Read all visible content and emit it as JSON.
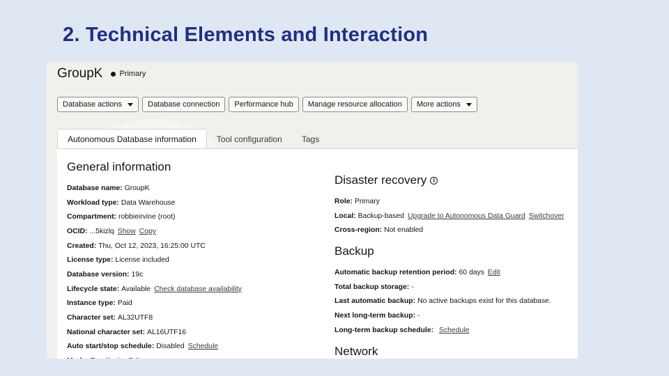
{
  "slide": {
    "title": "2. Technical Elements and Interaction"
  },
  "header": {
    "db_name": "GroupK",
    "status": "Primary"
  },
  "actions": {
    "database_actions": "Database actions",
    "database_connection": "Database connection",
    "performance_hub": "Performance hub",
    "manage_resource": "Manage resource allocation",
    "more_actions": "More actions"
  },
  "tabs": [
    {
      "label": "Autonomous Database information"
    },
    {
      "label": "Tool configuration"
    },
    {
      "label": "Tags"
    }
  ],
  "general": {
    "title": "General information",
    "rows": [
      {
        "label": "Database name:",
        "value": "GroupK"
      },
      {
        "label": "Workload type:",
        "value": "Data Warehouse"
      },
      {
        "label": "Compartment:",
        "value": "robbieirvine (root)"
      },
      {
        "label": "OCID:",
        "value": "...5kizlq",
        "link1": "Show",
        "link2": "Copy"
      },
      {
        "label": "Created:",
        "value": "Thu, Oct 12, 2023, 16:25:00 UTC"
      },
      {
        "label": "License type:",
        "value": "License included"
      },
      {
        "label": "Database version:",
        "value": "19c"
      },
      {
        "label": "Lifecycle state:",
        "value": "Available",
        "link1": "Check database availability"
      },
      {
        "label": "Instance type:",
        "value": "Paid"
      },
      {
        "label": "Character set:",
        "value": "AL32UTF8"
      },
      {
        "label": "National character set:",
        "value": "AL16UTF16"
      },
      {
        "label": "Auto start/stop schedule:",
        "value": "Disabled",
        "link1": "Schedule"
      },
      {
        "label": "Mode:",
        "value": "Read/write",
        "link1": "Edit"
      }
    ]
  },
  "disaster": {
    "title": "Disaster recovery",
    "info_icon": "i",
    "rows": [
      {
        "label": "Role:",
        "value": "Primary"
      },
      {
        "label": "Local:",
        "value": "Backup-based",
        "link1": "Upgrade to Autonomous Data Guard",
        "link2": "Switchover"
      },
      {
        "label": "Cross-region:",
        "value": "Not enabled"
      }
    ]
  },
  "backup": {
    "title": "Backup",
    "rows": [
      {
        "label": "Automatic backup retention period:",
        "value": "60 days",
        "link1": "Edit"
      },
      {
        "label": "Total backup storage:",
        "value": "-"
      },
      {
        "label": "Last automatic backup:",
        "value": "No active backups exist for this database."
      },
      {
        "label": "Next long-term backup:",
        "value": "-"
      },
      {
        "label": "Long-term backup schedule:",
        "value": "",
        "link1": "Schedule"
      }
    ]
  },
  "network": {
    "title": "Network"
  }
}
